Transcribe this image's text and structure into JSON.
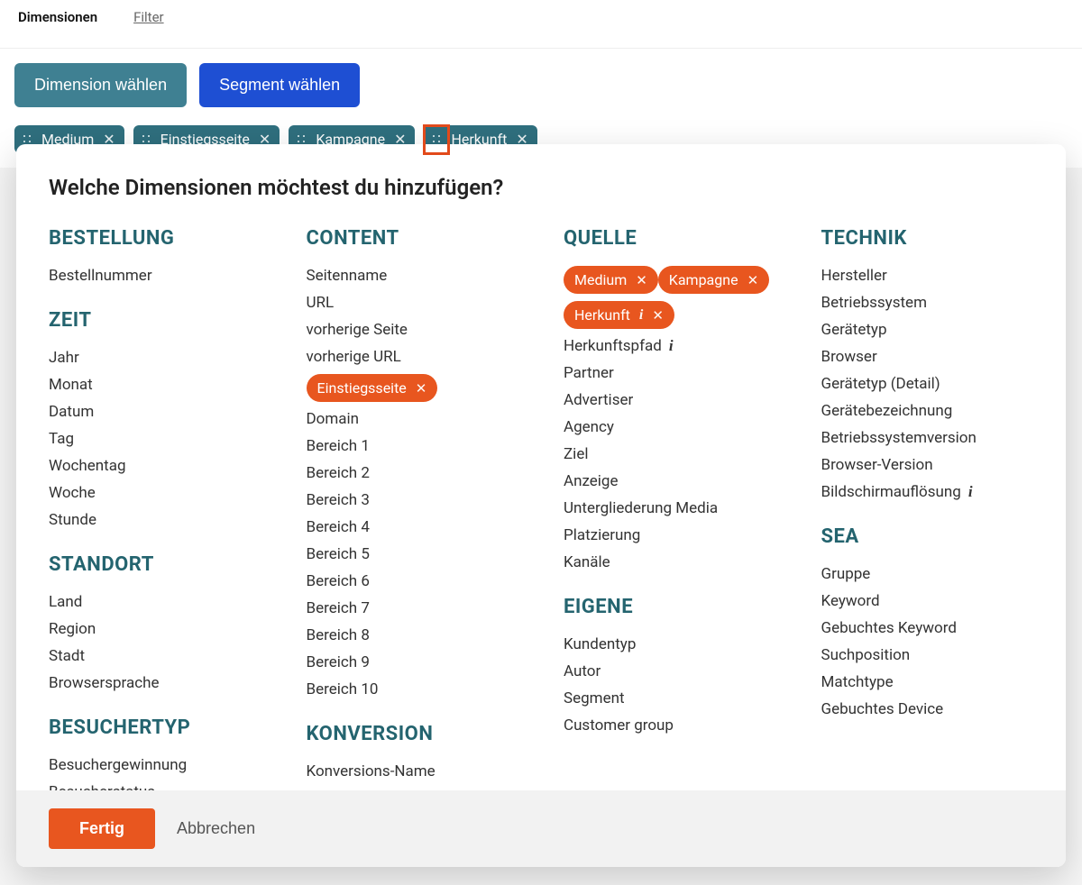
{
  "tabs": {
    "dimensions": "Dimensionen",
    "filter": "Filter"
  },
  "buttons": {
    "choose_dimension": "Dimension wählen",
    "choose_segment": "Segment wählen"
  },
  "chips": [
    {
      "label": "Medium"
    },
    {
      "label": "Einstiegsseite"
    },
    {
      "label": "Kampagne"
    },
    {
      "label": "Herkunft"
    }
  ],
  "panel": {
    "title": "Welche Dimensionen möchtest du hinzufügen?",
    "footer": {
      "done": "Fertig",
      "cancel": "Abbrechen"
    }
  },
  "groups": {
    "bestellung": {
      "title": "BESTELLUNG",
      "items": [
        "Bestellnummer"
      ]
    },
    "zeit": {
      "title": "ZEIT",
      "items": [
        "Jahr",
        "Monat",
        "Datum",
        "Tag",
        "Wochentag",
        "Woche",
        "Stunde"
      ]
    },
    "standort": {
      "title": "STANDORT",
      "items": [
        "Land",
        "Region",
        "Stadt",
        "Browsersprache"
      ]
    },
    "besuchertyp": {
      "title": "BESUCHERTYP",
      "items": [
        "Besuchergewinnung",
        "Besucherstatus"
      ]
    },
    "content": {
      "title": "CONTENT",
      "items_before": [
        "Seitenname",
        "URL",
        "vorherige Seite",
        "vorherige URL"
      ],
      "selected": "Einstiegsseite",
      "items_after": [
        "Domain",
        "Bereich 1",
        "Bereich 2",
        "Bereich 3",
        "Bereich 4",
        "Bereich 5",
        "Bereich 6",
        "Bereich 7",
        "Bereich 8",
        "Bereich 9",
        "Bereich 10"
      ]
    },
    "konversion": {
      "title": "KONVERSION",
      "items": [
        "Konversions-Name"
      ]
    },
    "quelle": {
      "title": "QUELLE",
      "selected": [
        "Medium",
        "Kampagne",
        "Herkunft"
      ],
      "herkunftspfad": "Herkunftspfad",
      "items": [
        "Partner",
        "Advertiser",
        "Agency",
        "Ziel",
        "Anzeige",
        "Untergliederung Media",
        "Platzierung",
        "Kanäle"
      ]
    },
    "eigene": {
      "title": "EIGENE",
      "items": [
        "Kundentyp",
        "Autor",
        "Segment",
        "Customer group"
      ]
    },
    "technik": {
      "title": "TECHNIK",
      "items": [
        "Hersteller",
        "Betriebssystem",
        "Gerätetyp",
        "Browser",
        "Gerätetyp (Detail)",
        "Gerätebezeichnung",
        "Betriebssystemversion",
        "Browser-Version"
      ],
      "bildschirm": "Bildschirmauflösung"
    },
    "sea": {
      "title": "SEA",
      "items": [
        "Gruppe",
        "Keyword",
        "Gebuchtes Keyword",
        "Suchposition",
        "Matchtype",
        "Gebuchtes Device"
      ]
    }
  }
}
